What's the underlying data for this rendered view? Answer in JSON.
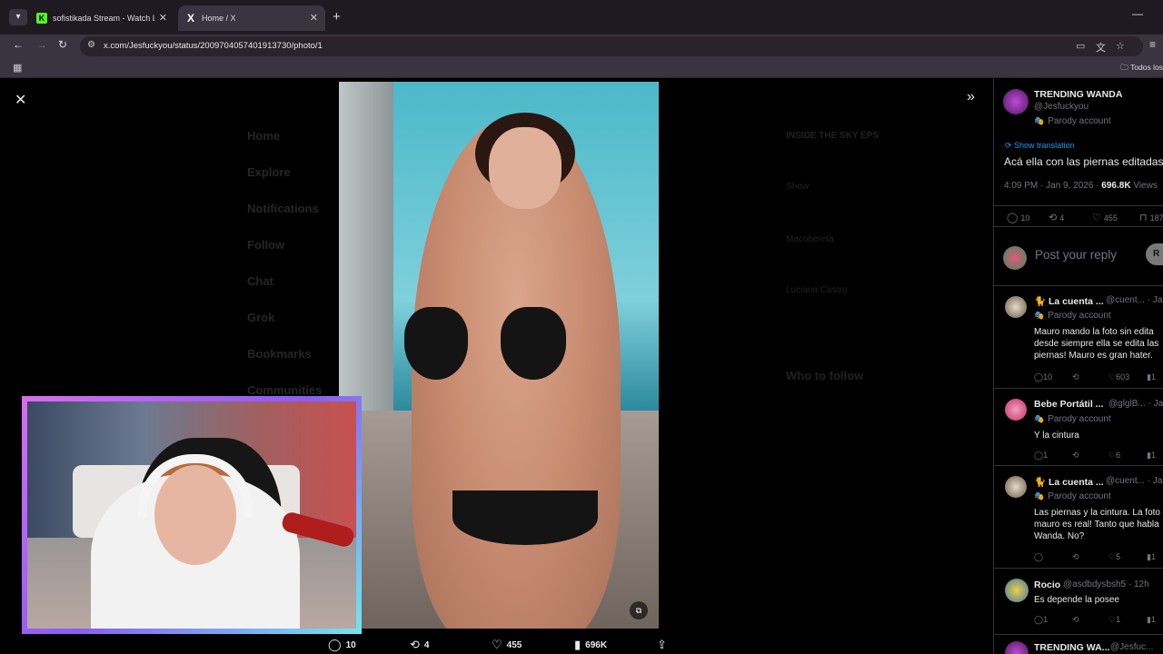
{
  "browser": {
    "tabs": [
      {
        "title": "sofistikada Stream - Watch Live",
        "favicon": "K"
      },
      {
        "title": "Home / X",
        "favicon": "X"
      }
    ],
    "url": "x.com/Jesfuckyou/status/2009704057401913730/photo/1",
    "bookmarks_folder": "Todos los"
  },
  "background_nav": [
    "Home",
    "Explore",
    "Notifications",
    "Follow",
    "Chat",
    "Grok",
    "Bookmarks",
    "Communities"
  ],
  "background_text": {
    "section_title": "Who to follow",
    "sidebar_header": "INSIDE THE SKY EPS",
    "items": [
      "Show",
      "Macobereta",
      "Luciana Castro"
    ]
  },
  "photo_actions": {
    "replies": "10",
    "reposts": "4",
    "likes": "455",
    "views": "696K"
  },
  "post": {
    "author_name": "TRENDING WANDA",
    "author_handle": "@Jesfuckyou",
    "parody_label": "Parody account",
    "show_translation": "Show translation",
    "text": "Acá ella con las piernas editadas",
    "time": "4:09 PM · Jan 9, 2026 ·",
    "views_count": "696.8K",
    "views_label": "Views",
    "replies": "10",
    "reposts": "4",
    "likes": "455",
    "bookmarks": "187"
  },
  "reply_box": {
    "placeholder": "Post your reply",
    "button": "R"
  },
  "replies": [
    {
      "name": "🐈 La cuenta ...",
      "handle": "@cuent... · Jan",
      "parody": "Parody account",
      "text": "Mauro mando la foto sin edita desde siempre ella se edita las piernas! Mauro es gran hater.",
      "replies": "10",
      "reposts": "",
      "likes": "603",
      "views": "1"
    },
    {
      "name": "Bebe Portátil ...",
      "handle": "@glglB... · Ja",
      "parody": "Parody account",
      "text": "Y la cintura",
      "replies": "1",
      "reposts": "",
      "likes": "6",
      "views": "1"
    },
    {
      "name": "🐈 La cuenta ...",
      "handle": "@cuent... · Ja",
      "parody": "Parody account",
      "text": "Las piernas y la cintura. La foto mauro es real! Tanto que habla Wanda. No?",
      "replies": "",
      "reposts": "",
      "likes": "5",
      "views": "1"
    },
    {
      "name": "Rocio",
      "handle": "@asdbdysbsh5 · 12h",
      "parody": "",
      "text": "Es depende la posee",
      "replies": "1",
      "reposts": "",
      "likes": "1",
      "views": "1"
    },
    {
      "name": "TRENDING WA...",
      "handle": "@Jesfuc...",
      "parody": "",
      "text": "",
      "replies": "",
      "reposts": "",
      "likes": "",
      "views": ""
    }
  ],
  "colors": {
    "accent": "#1d9bf0",
    "muted": "#71767b",
    "text": "#e7e9ea",
    "webcam_border": "#b56cf0"
  }
}
